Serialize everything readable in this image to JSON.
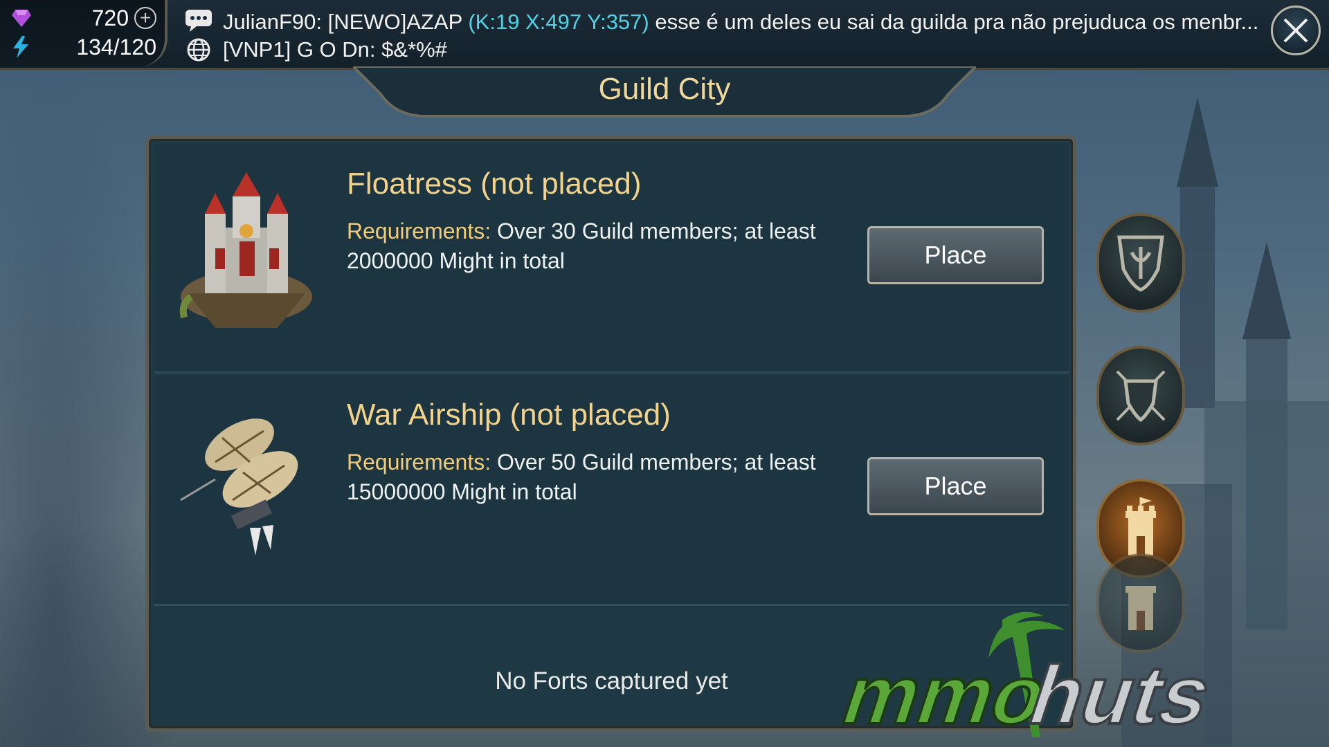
{
  "hud": {
    "gems": "720",
    "energy": "134/120",
    "plus_label": "+"
  },
  "chat": {
    "line1_user": "JulianF90: [NEWO]AZAP",
    "line1_coords": "(K:19 X:497 Y:357)",
    "line1_message": "esse é um deles eu sai da guilda pra não prejuduca os menbr...",
    "line2_text": "[VNP1] G O Dn: $&*%#"
  },
  "window": {
    "title": "Guild City"
  },
  "items": [
    {
      "title": "Floatress (not placed)",
      "req_label": "Requirements:",
      "req_text": "Over 30 Guild members; at least 2000000 Might in total",
      "button": "Place"
    },
    {
      "title": "War Airship (not placed)",
      "req_label": "Requirements:",
      "req_text": "Over 50 Guild members; at least 15000000 Might in total",
      "button": "Place"
    }
  ],
  "forts": {
    "empty_text": "No Forts captured yet"
  },
  "side_nav": [
    "guild-crest-icon",
    "shield-swords-icon",
    "fort-tower-icon"
  ],
  "watermark": "mmohuts",
  "colors": {
    "panel_bg": "#1c3540",
    "title_gold": "#f3d38c",
    "coord_cyan": "#4fd3e6",
    "button_border": "#b7b4a5"
  }
}
